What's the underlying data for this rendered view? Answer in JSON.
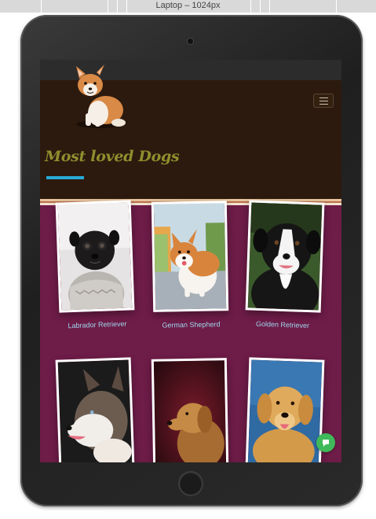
{
  "viewport_label": "Laptop – 1024px",
  "page": {
    "section_title": "Most loved Dogs"
  },
  "dogs": [
    {
      "name": "Labrador Retriever",
      "photo": "pug in grey knit sweater"
    },
    {
      "name": "German Shepherd",
      "photo": "corgi running on road"
    },
    {
      "name": "Golden Retriever",
      "photo": "black and white border collie"
    },
    {
      "name": "",
      "photo": "husky profile"
    },
    {
      "name": "",
      "photo": "golden retriever profile on dark red"
    },
    {
      "name": "",
      "photo": "golden retriever on blue"
    }
  ],
  "icons": {
    "logo": "corgi-logo",
    "menu": "hamburger-icon",
    "chat": "chat-icon"
  },
  "colors": {
    "page_bg": "#6e1c48",
    "header_bg": "#2c1a0f",
    "title": "#8e8f2d",
    "underline": "#27a9d6",
    "caption": "#9fd7ee",
    "chat": "#3fb95a"
  }
}
